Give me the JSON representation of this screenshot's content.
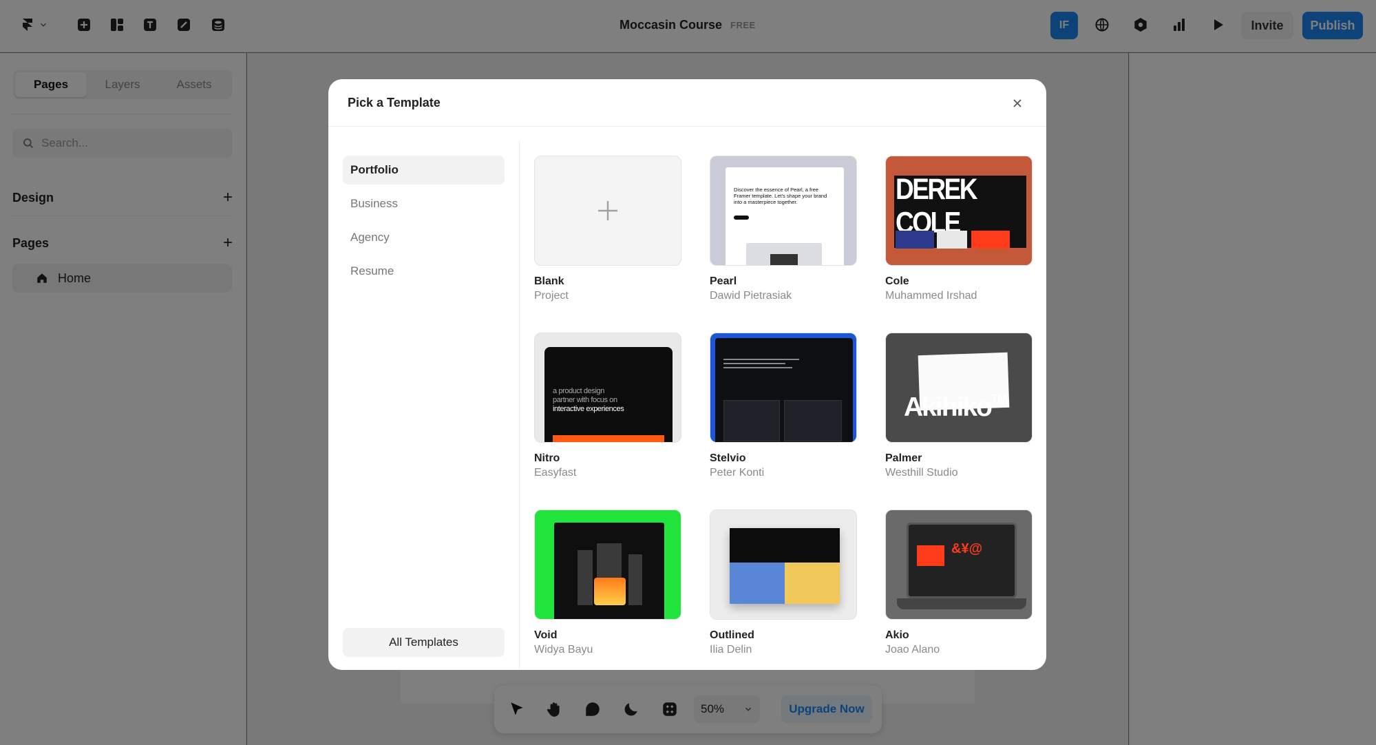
{
  "app": {
    "title": "Moccasin Course",
    "plan_badge": "FREE",
    "avatar_initials": "IF",
    "invite_label": "Invite",
    "publish_label": "Publish",
    "accent_color": "#1a87f0"
  },
  "toolbar_icons": [
    "framer-logo-icon",
    "insert-icon",
    "layout-icon",
    "text-icon",
    "vector-icon",
    "cms-icon"
  ],
  "header_icons": [
    "globe-icon",
    "settings-icon",
    "analytics-icon",
    "preview-play-icon"
  ],
  "sidebar": {
    "tabs": [
      {
        "label": "Pages",
        "active": true
      },
      {
        "label": "Layers",
        "active": false
      },
      {
        "label": "Assets",
        "active": false
      }
    ],
    "search_placeholder": "Search...",
    "sections": [
      {
        "label": "Design"
      },
      {
        "label": "Pages"
      }
    ],
    "pages": [
      {
        "label": "Home"
      }
    ]
  },
  "bottom_toolbar": {
    "tools": [
      "pointer-icon",
      "hand-icon",
      "comment-icon",
      "theme-moon-icon",
      "components-icon"
    ],
    "zoom": "50%",
    "upgrade_label": "Upgrade Now"
  },
  "modal": {
    "title": "Pick a Template",
    "categories": [
      {
        "label": "Portfolio",
        "active": true
      },
      {
        "label": "Business",
        "active": false
      },
      {
        "label": "Agency",
        "active": false
      },
      {
        "label": "Resume",
        "active": false
      }
    ],
    "all_templates_label": "All Templates",
    "templates": [
      {
        "name": "Blank",
        "author": "Project"
      },
      {
        "name": "Pearl",
        "author": "Dawid Pietrasiak",
        "thumb_text": "Discover the essence of Pearl, a free Framer template. Let's shape your brand into a masterpiece together."
      },
      {
        "name": "Cole",
        "author": "Muhammed Irshad",
        "thumb_text": "DEREK COLE"
      },
      {
        "name": "Nitro",
        "author": "Easyfast",
        "thumb_text_a": "a product design",
        "thumb_text_b": "partner with focus on",
        "thumb_text_c": "interactive experiences"
      },
      {
        "name": "Stelvio",
        "author": "Peter Konti"
      },
      {
        "name": "Palmer",
        "author": "Westhill Studio",
        "thumb_text": "Akihiko",
        "thumb_mark": "TM"
      },
      {
        "name": "Void",
        "author": "Widya Bayu"
      },
      {
        "name": "Outlined",
        "author": "Ilia Delin"
      },
      {
        "name": "Akio",
        "author": "Joao Alano",
        "thumb_text": "&¥@"
      }
    ]
  }
}
